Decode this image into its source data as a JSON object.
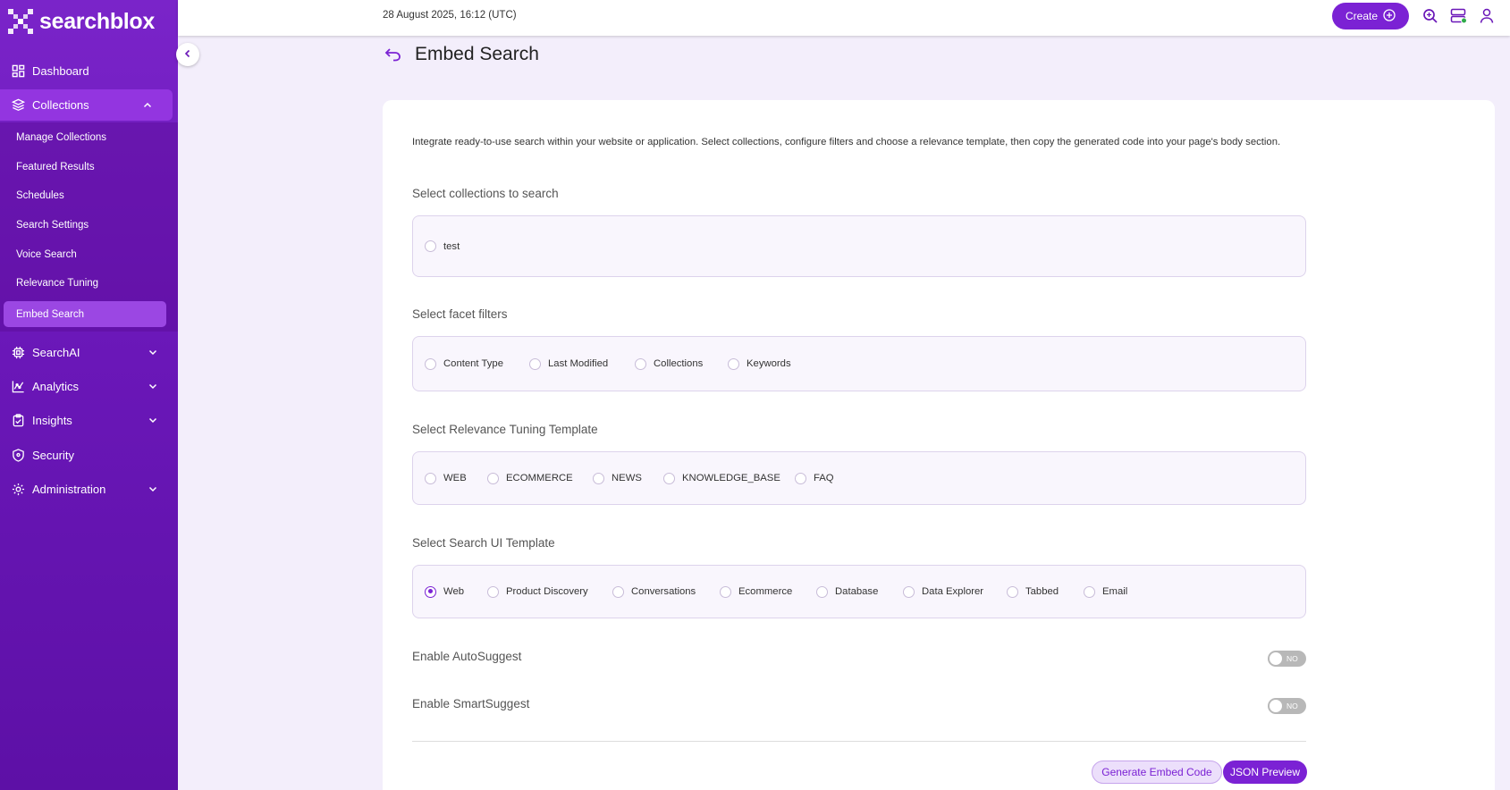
{
  "brand": {
    "name": "searchblox"
  },
  "topbar": {
    "datetime": "28 August 2025, 16:12 (UTC)",
    "create_label": "Create"
  },
  "sidebar": {
    "items": [
      {
        "label": "Dashboard",
        "icon": "dashboard-icon"
      },
      {
        "label": "Collections",
        "icon": "layers-icon",
        "expanded": true
      },
      {
        "label": "SearchAI",
        "icon": "chip-icon"
      },
      {
        "label": "Analytics",
        "icon": "analytics-icon"
      },
      {
        "label": "Insights",
        "icon": "clipboard-icon"
      },
      {
        "label": "Security",
        "icon": "shield-icon"
      },
      {
        "label": "Administration",
        "icon": "gear-icon"
      }
    ],
    "collections_sub": [
      "Manage Collections",
      "Featured Results",
      "Schedules",
      "Search Settings",
      "Voice Search",
      "Relevance Tuning",
      "Embed Search"
    ],
    "active_sub": "Embed Search"
  },
  "page": {
    "title": "Embed Search",
    "intro": "Integrate ready-to-use search within your website or application. Select collections, configure filters and choose a relevance template, then copy the generated code into your page's body section.",
    "collections": {
      "label": "Select collections to search",
      "options": [
        "test"
      ]
    },
    "facets": {
      "label": "Select facet filters",
      "options": [
        "Content Type",
        "Last Modified",
        "Collections",
        "Keywords"
      ]
    },
    "relevance": {
      "label": "Select Relevance Tuning Template",
      "options": [
        "WEB",
        "ECOMMERCE",
        "NEWS",
        "KNOWLEDGE_BASE",
        "FAQ"
      ]
    },
    "ui_template": {
      "label": "Select Search UI Template",
      "options": [
        "Web",
        "Product Discovery",
        "Conversations",
        "Ecommerce",
        "Database",
        "Data Explorer",
        "Tabbed",
        "Email"
      ],
      "selected": "Web"
    },
    "autosuggest": {
      "label": "Enable AutoSuggest",
      "state": "NO"
    },
    "smartsuggest": {
      "label": "Enable SmartSuggest",
      "state": "NO"
    },
    "buttons": {
      "generate": "Generate Embed Code",
      "json": "JSON Preview"
    }
  },
  "colors": {
    "accent": "#7b22d4",
    "sidebar": "#6a17b8"
  }
}
